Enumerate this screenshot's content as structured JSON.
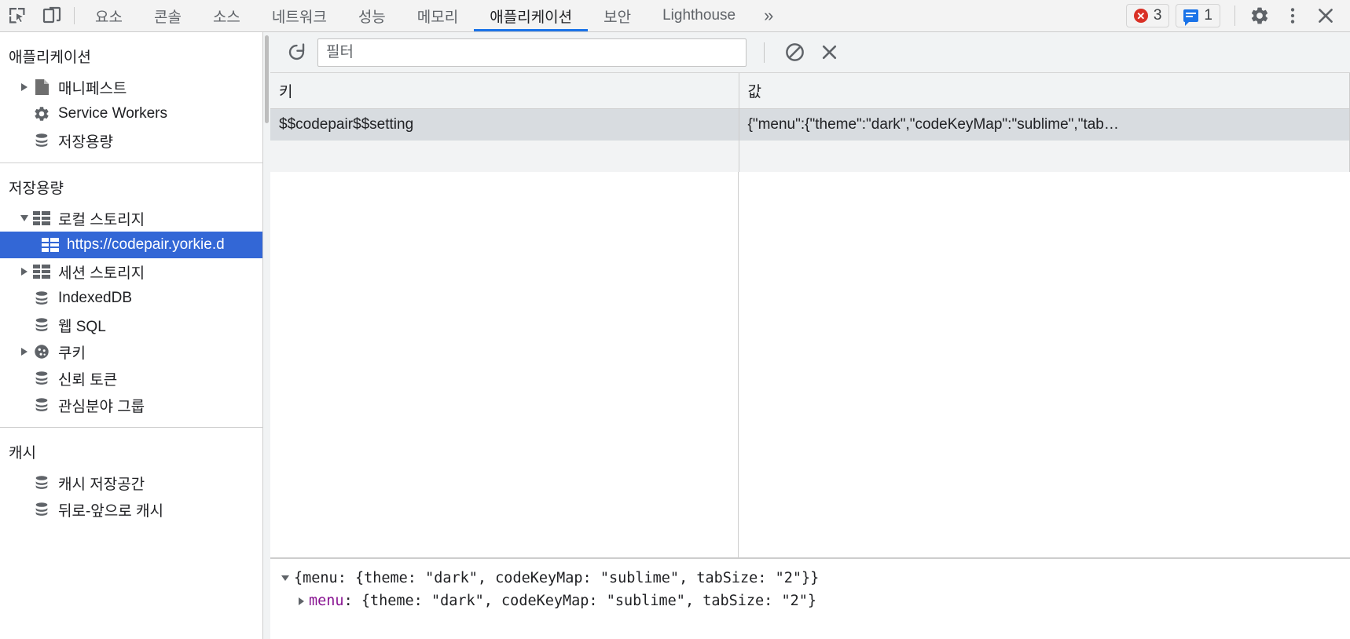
{
  "toolbar": {
    "inspect_icon": "inspect-element-icon",
    "device_icon": "device-toolbar-icon",
    "tabs": [
      {
        "label": "요소",
        "active": false
      },
      {
        "label": "콘솔",
        "active": false
      },
      {
        "label": "소스",
        "active": false
      },
      {
        "label": "네트워크",
        "active": false
      },
      {
        "label": "성능",
        "active": false
      },
      {
        "label": "메모리",
        "active": false
      },
      {
        "label": "애플리케이션",
        "active": true
      },
      {
        "label": "보안",
        "active": false
      },
      {
        "label": "Lighthouse",
        "active": false
      }
    ],
    "more_tabs_label": "»",
    "error_count": "3",
    "message_count": "1",
    "settings_icon": "gear-icon",
    "menu_icon": "more-vertical-icon",
    "close_icon": "close-icon"
  },
  "sidebar": {
    "sections": [
      {
        "title": "애플리케이션",
        "items": [
          {
            "label": "매니페스트",
            "icon": "manifest-document-icon",
            "arrow": "right",
            "indent": 1,
            "selected": false
          },
          {
            "label": "Service Workers",
            "icon": "gear-icon",
            "arrow": "none",
            "indent": 1,
            "selected": false
          },
          {
            "label": "저장용량",
            "icon": "database-icon",
            "arrow": "none",
            "indent": 1,
            "selected": false
          }
        ]
      },
      {
        "title": "저장용량",
        "items": [
          {
            "label": "로컬 스토리지",
            "icon": "table-grid-icon",
            "arrow": "down",
            "indent": 1,
            "selected": false
          },
          {
            "label": "https://codepair.yorkie.d",
            "icon": "table-grid-icon",
            "arrow": "none",
            "indent": 2,
            "selected": true
          },
          {
            "label": "세션 스토리지",
            "icon": "table-grid-icon",
            "arrow": "right",
            "indent": 1,
            "selected": false
          },
          {
            "label": "IndexedDB",
            "icon": "database-icon",
            "arrow": "none",
            "indent": 1,
            "selected": false
          },
          {
            "label": "웹 SQL",
            "icon": "database-icon",
            "arrow": "none",
            "indent": 1,
            "selected": false
          },
          {
            "label": "쿠키",
            "icon": "cookie-icon",
            "arrow": "right",
            "indent": 1,
            "selected": false
          },
          {
            "label": "신뢰 토큰",
            "icon": "database-icon",
            "arrow": "none",
            "indent": 1,
            "selected": false
          },
          {
            "label": "관심분야 그룹",
            "icon": "database-icon",
            "arrow": "none",
            "indent": 1,
            "selected": false
          }
        ]
      },
      {
        "title": "캐시",
        "items": [
          {
            "label": "캐시 저장공간",
            "icon": "database-icon",
            "arrow": "none",
            "indent": 1,
            "selected": false
          },
          {
            "label": "뒤로-앞으로 캐시",
            "icon": "database-icon",
            "arrow": "none",
            "indent": 1,
            "selected": false
          }
        ]
      }
    ]
  },
  "filter_bar": {
    "refresh_icon": "refresh-icon",
    "filter_value": "",
    "filter_placeholder": "필터",
    "clear_all_icon": "clear-all-icon",
    "delete_selected_icon": "delete-selected-icon"
  },
  "table": {
    "columns": [
      "키",
      "값"
    ],
    "rows": [
      {
        "key": "$$codepair$$setting",
        "value": "{\"menu\":{\"theme\":\"dark\",\"codeKeyMap\":\"sublime\",\"tab…",
        "selected": true
      }
    ]
  },
  "preview": {
    "line1_prefix": "{menu: {theme: \"dark\", codeKeyMap: \"sublime\", tabSize: \"2\"}}",
    "line2_key": "menu",
    "line2_rest": ": {theme: \"dark\", codeKeyMap: \"sublime\", tabSize: \"2\"}"
  },
  "colors": {
    "accent": "#1a73e8",
    "selection": "#3367d6",
    "error": "#d93025",
    "json_key": "#881391"
  }
}
